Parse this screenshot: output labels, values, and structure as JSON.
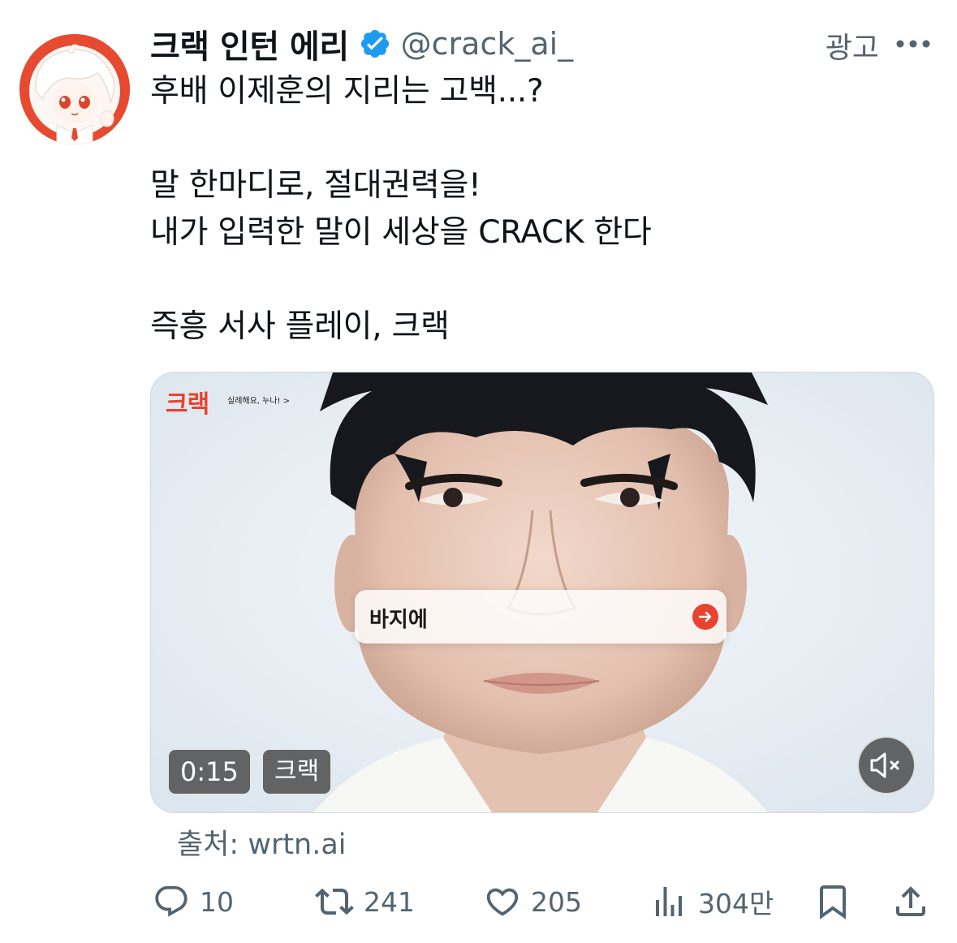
{
  "tweet": {
    "display_name": "크랙 인턴 에리",
    "handle": "@crack_ai_",
    "ad_label": "광고",
    "text_lines": [
      "후배 이제훈의 지리는 고백...?",
      "",
      "말 한마디로, 절대권력을!",
      "내가 입력한 말이 세상을 CRACK 한다",
      "",
      "즉흥 서사 플레이, 크랙"
    ]
  },
  "media": {
    "brand_logo": "크랙",
    "brand_tagline": "실례해요, 누나! >",
    "prompt_text": "바지에",
    "duration": "0:15",
    "channel": "크랙"
  },
  "source": "출처: wrtn.ai",
  "actions": {
    "replies": "10",
    "reposts": "241",
    "likes": "205",
    "views": "304만"
  },
  "colors": {
    "verified": "#1d9bf0",
    "brand_red": "#e8432f",
    "secondary_text": "#536471",
    "primary_text": "#0f1419"
  },
  "icons": {
    "verified": "verified-badge-icon",
    "more": "more-dots-icon",
    "reply": "speech-bubble-icon",
    "repost": "repost-arrows-icon",
    "like": "heart-icon",
    "views": "bar-chart-icon",
    "bookmark": "bookmark-icon",
    "share": "share-upload-icon",
    "mute": "speaker-muted-icon",
    "send": "arrow-right-icon"
  }
}
